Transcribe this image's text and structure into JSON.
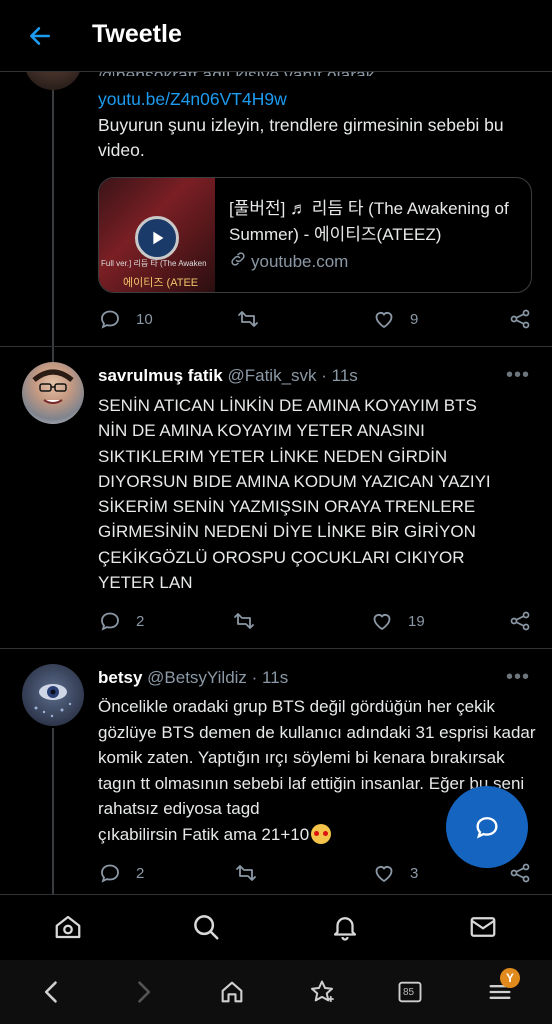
{
  "header": {
    "title": "Tweetle"
  },
  "tweet1": {
    "reply_to_partial": "@bensokratt adlı kişiye yanıt olarak",
    "link": "youtu.be/Z4n06VT4H9w",
    "text": "Buyurun şunu izleyin, trendlere girmesinin sebebi bu video.",
    "card": {
      "title": "[풀버전] ♬ 리듬 타 (The Awakening of Summer) - 에이티즈(ATEEZ)",
      "domain": "youtube.com",
      "thumb_caption_top": "Full ver.] 리듬 타 (The Awaken",
      "thumb_caption_bottom": "에이티즈 (ATEE"
    },
    "replies": "10",
    "likes": "9"
  },
  "tweet2": {
    "name": "savrulmuş fatik",
    "handle": "@Fatik_svk",
    "time": "· 11s",
    "text": "SENİN ATICAN LİNKİN DE AMINA KOYAYIM BTS NİN DE AMINA KOYAYIM YETER ANASINI SIKTIKLERIM YETER LİNKE NEDEN GİRDİN DIYORSUN BIDE AMINA KODUM YAZICAN YAZIYI SİKERİM SENİN YAZMIŞSIN ORAYA TRENLERE GİRMESİNİN NEDENİ DİYE LİNKE BİR GİRİYON ÇEKİKGÖZLÜ OROSPU ÇOCUKLARI CIKIYOR YETER LAN",
    "replies": "2",
    "likes": "19"
  },
  "tweet3": {
    "name": "betsy",
    "handle": "@BetsyYildiz",
    "time": "· 11s",
    "text": "Öncelikle oradaki grup BTS değil gördüğün her çekik gözlüye BTS demen de kullanıcı adındaki 31 esprisi kadar komik zaten. Yaptığın ırçı söylemi bi kenara bırakırsak tagın tt olmasının sebebi laf ettiğin insanlar. Eğer bu seni rahatsız ediyosa tagd",
    "text_tail": "çıkabilirsin Fatik ama 21+10",
    "replies": "2",
    "likes": "3"
  },
  "more_label": "•••",
  "system": {
    "tabs_count": "85",
    "badge": "Y"
  },
  "colors": {
    "accent": "#1d9bf0",
    "fab": "#1565c0",
    "like_badge": "#e08a1e"
  }
}
